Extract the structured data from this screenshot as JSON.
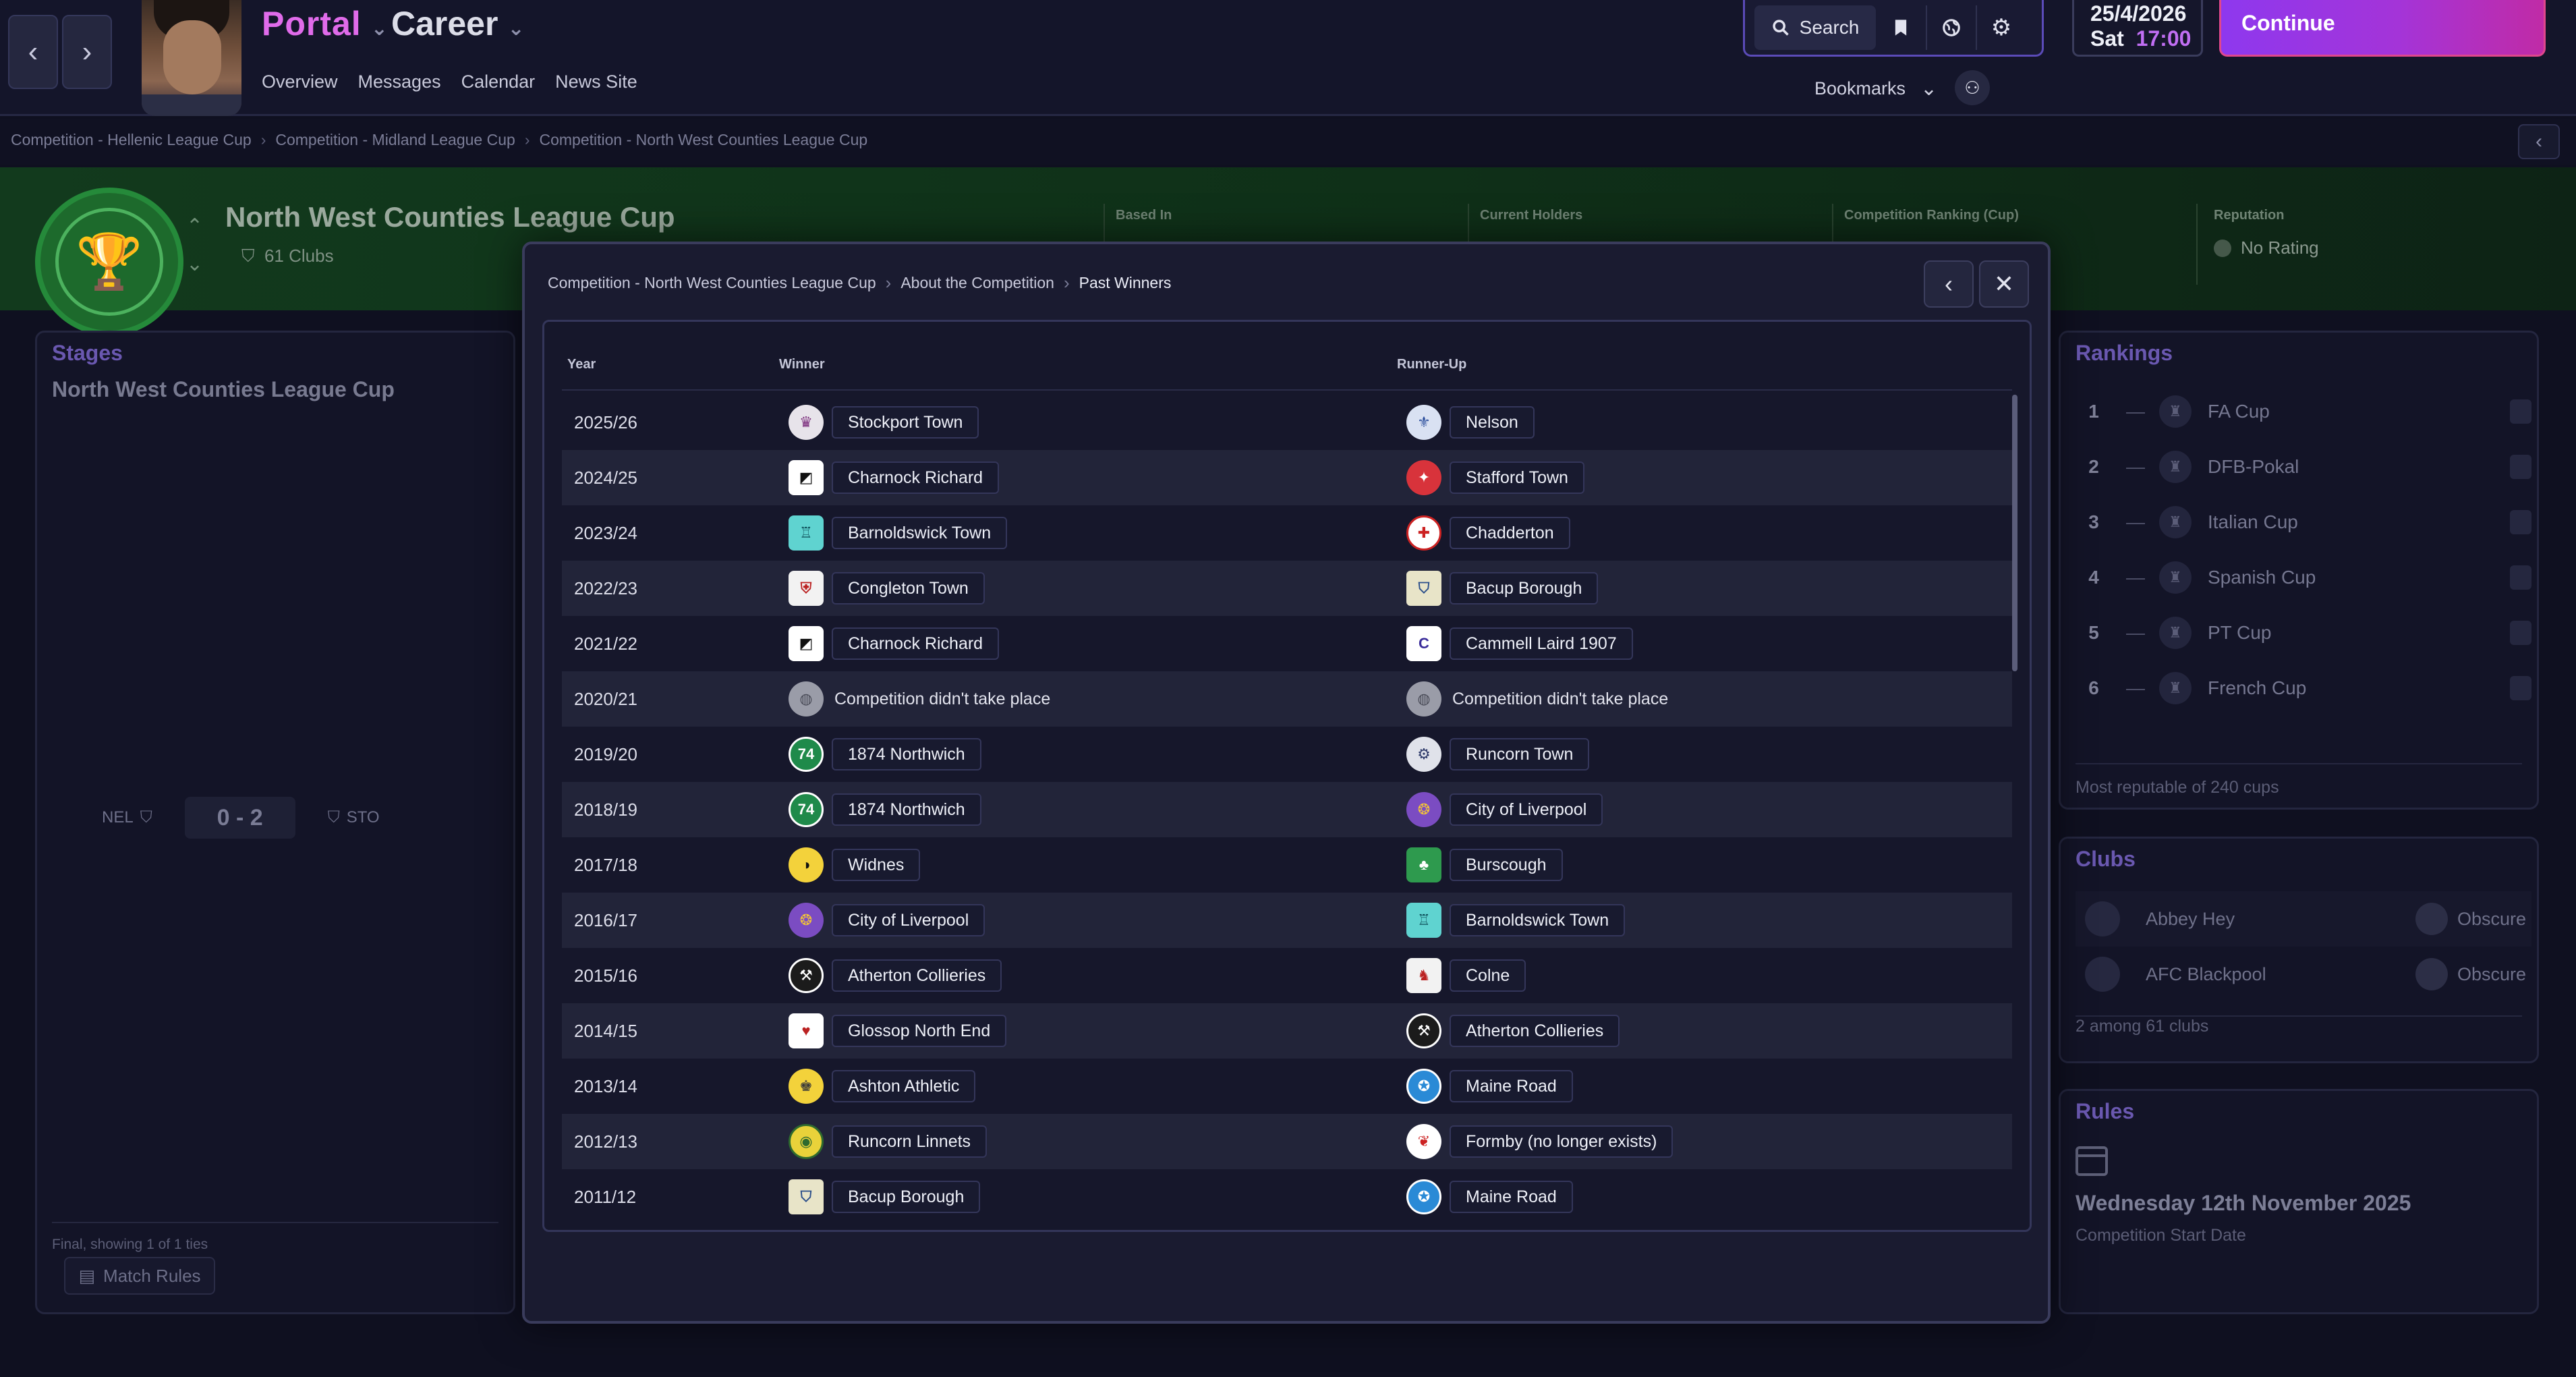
{
  "topbar": {
    "back_label": "‹",
    "forward_label": "›",
    "portal_label": "Portal",
    "career_label": "Career",
    "subnav": [
      "Overview",
      "Messages",
      "Calendar",
      "News Site"
    ],
    "search_label": "Search",
    "date": "25/4/2026",
    "day": "Sat",
    "time": "17:00",
    "continue_label": "Continue",
    "bookmarks_label": "Bookmarks"
  },
  "breadcrumb": [
    "Competition - Hellenic League Cup",
    "Competition - Midland League Cup",
    "Competition - North West Counties League Cup"
  ],
  "hero": {
    "title": "North West Counties League Cup",
    "clubs": "61 Clubs",
    "stats": [
      "Based In",
      "Current Holders",
      "Competition Ranking (Cup)",
      "Reputation"
    ],
    "reputation_value": "No Rating"
  },
  "stages": {
    "title": "Stages",
    "subtitle": "North West Counties League Cup",
    "home": "NEL",
    "away": "STO",
    "score": "0 - 2",
    "footer": "Final, showing 1 of 1 ties",
    "match_rules": "Match Rules"
  },
  "rankings": {
    "title": "Rankings",
    "items": [
      {
        "rank": "1",
        "dash": "—",
        "name": "FA Cup"
      },
      {
        "rank": "2",
        "dash": "—",
        "name": "DFB-Pokal"
      },
      {
        "rank": "3",
        "dash": "—",
        "name": "Italian Cup"
      },
      {
        "rank": "4",
        "dash": "—",
        "name": "Spanish Cup"
      },
      {
        "rank": "5",
        "dash": "—",
        "name": "PT Cup"
      },
      {
        "rank": "6",
        "dash": "—",
        "name": "French Cup"
      }
    ],
    "note": "Most reputable of 240 cups"
  },
  "clubs": {
    "title": "Clubs",
    "items": [
      {
        "name": "Abbey Hey",
        "rep": "Obscure"
      },
      {
        "name": "AFC Blackpool",
        "rep": "Obscure"
      }
    ],
    "note": "2 among 61 clubs"
  },
  "rules": {
    "title": "Rules",
    "date": "Wednesday 12th November 2025",
    "label": "Competition Start Date"
  },
  "modal": {
    "crumbs": [
      "Competition - North West Counties League Cup",
      "About the Competition",
      "Past Winners"
    ],
    "columns": {
      "year": "Year",
      "winner": "Winner",
      "runner": "Runner-Up"
    },
    "rows": [
      {
        "year": "2025/26",
        "winner": "Stockport Town",
        "runner": "Nelson"
      },
      {
        "year": "2024/25",
        "winner": "Charnock Richard",
        "runner": "Stafford Town"
      },
      {
        "year": "2023/24",
        "winner": "Barnoldswick Town",
        "runner": "Chadderton"
      },
      {
        "year": "2022/23",
        "winner": "Congleton Town",
        "runner": "Bacup Borough"
      },
      {
        "year": "2021/22",
        "winner": "Charnock Richard",
        "runner": "Cammell Laird 1907"
      },
      {
        "year": "2020/21",
        "winner": "Competition didn't take place",
        "runner": "Competition didn't take place"
      },
      {
        "year": "2019/20",
        "winner": "1874 Northwich",
        "runner": "Runcorn Town"
      },
      {
        "year": "2018/19",
        "winner": "1874 Northwich",
        "runner": "City of Liverpool"
      },
      {
        "year": "2017/18",
        "winner": "Widnes",
        "runner": "Burscough"
      },
      {
        "year": "2016/17",
        "winner": "City of Liverpool",
        "runner": "Barnoldswick Town"
      },
      {
        "year": "2015/16",
        "winner": "Atherton Collieries",
        "runner": "Colne"
      },
      {
        "year": "2014/15",
        "winner": "Glossop North End",
        "runner": "Atherton Collieries"
      },
      {
        "year": "2013/14",
        "winner": "Ashton Athletic",
        "runner": "Maine Road"
      },
      {
        "year": "2012/13",
        "winner": "Runcorn Linnets",
        "runner": "Formby (no longer exists)"
      },
      {
        "year": "2011/12",
        "winner": "Bacup Borough",
        "runner": "Maine Road"
      }
    ]
  },
  "colors": {
    "accent_purple": "#e06bea",
    "continue_gradient_start": "#8e38ee",
    "hero_green": "#123a1d"
  }
}
